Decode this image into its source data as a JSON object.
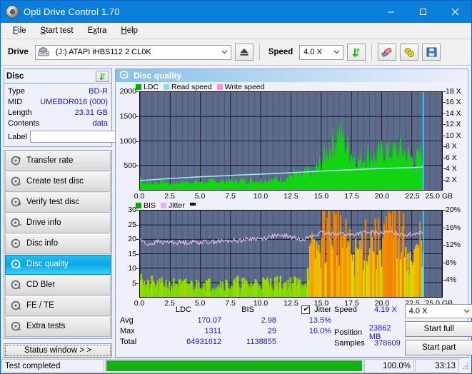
{
  "window": {
    "title": "Opti Drive Control 1.70",
    "icon": "disc-icon",
    "minimize": "–",
    "maximize": "□",
    "close": "✕"
  },
  "menu": [
    {
      "label": "File",
      "accel": "F"
    },
    {
      "label": "Start test",
      "accel": "S"
    },
    {
      "label": "Extra",
      "accel": "x"
    },
    {
      "label": "Help",
      "accel": "H"
    }
  ],
  "toolbar": {
    "drive_label": "Drive",
    "drive_value": "(J:)  ATAPI iHBS112  2 CL0K",
    "eject_icon": "eject-icon",
    "speed_label": "Speed",
    "speed_value": "4.0 X",
    "refresh_icon": "refresh-icon",
    "erase_icon": "eraser-icon",
    "disc_tools_icon": "disc-tools-icon",
    "save_icon": "save-icon"
  },
  "disc_panel": {
    "title": "Disc",
    "refresh_icon": "refresh-icon",
    "rows": [
      {
        "key": "Type",
        "value": "BD-R"
      },
      {
        "key": "MID",
        "value": "UMEBDR016 (000)"
      },
      {
        "key": "Length",
        "value": "23.31 GB"
      },
      {
        "key": "Contents",
        "value": "data"
      }
    ],
    "label_key": "Label",
    "label_value": "",
    "label_placeholder": "",
    "label_button_icon": "disc-icon"
  },
  "sidebar": {
    "items": [
      {
        "label": "Transfer rate",
        "icon": "disc-test-icon",
        "active": false
      },
      {
        "label": "Create test disc",
        "icon": "disc-write-icon",
        "active": false
      },
      {
        "label": "Verify test disc",
        "icon": "disc-verify-icon",
        "active": false
      },
      {
        "label": "Drive info",
        "icon": "drive-info-icon",
        "active": false
      },
      {
        "label": "Disc info",
        "icon": "disc-info-icon",
        "active": false
      },
      {
        "label": "Disc quality",
        "icon": "disc-quality-icon",
        "active": true
      },
      {
        "label": "CD Bler",
        "icon": "disc-bler-icon",
        "active": false
      },
      {
        "label": "FE / TE",
        "icon": "disc-fete-icon",
        "active": false
      },
      {
        "label": "Extra tests",
        "icon": "disc-extra-icon",
        "active": false
      }
    ],
    "status_window_button": "Status window > >"
  },
  "content": {
    "header_title": "Disc quality",
    "header_icon": "disc-quality-icon"
  },
  "chart_data": [
    {
      "id": "top",
      "type": "area",
      "title": "",
      "legend": [
        {
          "label": "LDC",
          "color": "#00a800"
        },
        {
          "label": "Read speed",
          "color": "#8fd8f0"
        },
        {
          "label": "Write speed",
          "color": "#ff8fd8"
        }
      ],
      "legend_position": "top-left",
      "xlabel": "GB",
      "xlim": [
        0.0,
        25.0
      ],
      "xticks": [
        "0.0",
        "2.5",
        "5.0",
        "7.5",
        "10.0",
        "12.5",
        "15.0",
        "17.5",
        "20.0",
        "22.5",
        "25.0"
      ],
      "ylabel": "",
      "ylim": [
        0,
        2000
      ],
      "yticks": [
        "500",
        "1000",
        "1500",
        "2000"
      ],
      "y2label": "",
      "y2lim": [
        0,
        18
      ],
      "y2ticks": [
        "2 X",
        "4 X",
        "6 X",
        "8 X",
        "10 X",
        "12 X",
        "14 X",
        "16 X",
        "18 X"
      ],
      "grid": true,
      "series": [
        {
          "name": "LDC",
          "color": "#00c800",
          "x": [
            0.0,
            0.3,
            0.6,
            1.0,
            1.5,
            2.0,
            2.5,
            3.0,
            3.5,
            4.0,
            4.5,
            5.0,
            5.5,
            6.0,
            6.5,
            7.0,
            7.5,
            8.0,
            8.5,
            9.0,
            9.5,
            10.0,
            10.5,
            11.0,
            11.5,
            12.0,
            12.4,
            12.8,
            13.1,
            13.5,
            13.9,
            14.2,
            14.6,
            15.0,
            15.3,
            15.6,
            15.9,
            16.2,
            16.5,
            16.8,
            17.1,
            17.4,
            17.7,
            18.0,
            18.4,
            18.8,
            19.2,
            19.6,
            20.0,
            20.4,
            20.8,
            21.2,
            21.6,
            22.0,
            22.4,
            22.8,
            23.2,
            23.4
          ],
          "values": [
            300,
            150,
            160,
            155,
            170,
            180,
            150,
            165,
            175,
            180,
            185,
            175,
            190,
            185,
            200,
            195,
            205,
            200,
            215,
            205,
            220,
            215,
            230,
            225,
            240,
            250,
            300,
            380,
            300,
            330,
            420,
            350,
            480,
            620,
            760,
            900,
            1050,
            1180,
            1311,
            1150,
            980,
            880,
            760,
            640,
            700,
            820,
            760,
            700,
            860,
            900,
            830,
            870,
            910,
            820,
            700,
            640,
            780,
            820
          ]
        },
        {
          "name": "Read speed",
          "color": "#a0e4fb",
          "x": [
            0.0,
            1.2,
            2.5,
            3.8,
            5.0,
            6.5,
            8.0,
            9.5,
            11.0,
            12.5,
            13.8,
            15.0,
            16.5,
            18.0,
            19.5,
            21.0,
            22.5,
            23.4
          ],
          "values": [
            1.7,
            1.9,
            2.1,
            2.25,
            2.4,
            2.55,
            2.7,
            2.85,
            3.0,
            3.15,
            3.3,
            3.45,
            3.6,
            3.75,
            3.9,
            4.0,
            4.1,
            4.19
          ]
        }
      ],
      "cursor_x": 23.45,
      "cursor_color": "#38e0ff"
    },
    {
      "id": "bottom",
      "type": "bar",
      "title": "",
      "legend": [
        {
          "label": "BIS",
          "color": "#00a800"
        },
        {
          "label": "Jitter",
          "color": "#e6b4e6"
        }
      ],
      "legend_position": "top-left",
      "xlabel": "GB",
      "xlim": [
        0.0,
        25.0
      ],
      "xticks": [
        "0.0",
        "2.5",
        "5.0",
        "7.5",
        "10.0",
        "12.5",
        "15.0",
        "17.5",
        "20.0",
        "22.5",
        "25.0"
      ],
      "ylabel": "",
      "ylim": [
        0,
        30
      ],
      "yticks": [
        "5",
        "10",
        "15",
        "20",
        "25",
        "30"
      ],
      "y2label": "",
      "y2lim": [
        0,
        20
      ],
      "y2ticks": [
        "4%",
        "8%",
        "12%",
        "16%",
        "20%"
      ],
      "grid": true,
      "series": [
        {
          "name": "BIS",
          "color_low": "#4cdc00",
          "color_mid": "#f0d400",
          "color_high": "#f08000",
          "x": [
            0.1,
            0.3,
            0.6,
            1.0,
            1.5,
            2.0,
            2.5,
            3.0,
            3.5,
            4.0,
            4.5,
            5.0,
            5.5,
            6.0,
            6.5,
            7.0,
            7.5,
            8.0,
            8.5,
            9.0,
            9.5,
            10.0,
            10.5,
            11.0,
            11.5,
            12.0,
            12.5,
            13.0,
            13.4,
            13.8,
            14.0,
            14.2,
            14.4,
            14.6,
            14.8,
            15.0,
            15.2,
            15.4,
            15.6,
            15.8,
            16.0,
            16.2,
            16.4,
            16.6,
            16.8,
            17.0,
            17.2,
            17.5,
            17.8,
            18.1,
            18.4,
            18.7,
            19.0,
            19.3,
            19.6,
            19.9,
            20.2,
            20.5,
            20.8,
            21.1,
            21.4,
            21.7,
            22.0,
            22.3,
            22.6,
            22.9,
            23.2,
            23.4
          ],
          "values": [
            11,
            5,
            4,
            5,
            4,
            5,
            4,
            5,
            4,
            5,
            4,
            5,
            5,
            4,
            5,
            5,
            4,
            5,
            5,
            4,
            5,
            5,
            5,
            5,
            5,
            5,
            5,
            5,
            5,
            6,
            12,
            16,
            14,
            18,
            15,
            20,
            25,
            22,
            29,
            24,
            27,
            22,
            26,
            20,
            23,
            18,
            20,
            15,
            14,
            16,
            18,
            21,
            19,
            22,
            17,
            20,
            23,
            21,
            24,
            22,
            26,
            19,
            21,
            13,
            12,
            15,
            20,
            22
          ]
        },
        {
          "name": "Jitter",
          "color": "#e8b8e8",
          "x": [
            0.0,
            0.5,
            1.0,
            1.5,
            2.0,
            2.5,
            3.0,
            3.5,
            4.0,
            4.5,
            5.0,
            5.5,
            6.0,
            6.5,
            7.0,
            7.5,
            8.0,
            8.5,
            9.0,
            9.5,
            10.0,
            10.5,
            11.0,
            11.5,
            12.0,
            12.5,
            13.0,
            13.5,
            14.0,
            14.5,
            15.0,
            15.5,
            16.0,
            16.5,
            17.0,
            17.5,
            18.0,
            18.5,
            19.0,
            19.5,
            20.0,
            20.5,
            21.0,
            21.5,
            22.0,
            22.5,
            23.0,
            23.4
          ],
          "values": [
            20.2,
            18.3,
            18.6,
            19.3,
            18.8,
            19.1,
            18.8,
            19.0,
            18.9,
            19.1,
            19.0,
            19.2,
            19.1,
            19.4,
            19.3,
            19.6,
            19.5,
            19.8,
            20.0,
            20.3,
            20.2,
            20.6,
            21.2,
            21.0,
            21.3,
            20.8,
            20.1,
            20.2,
            20.6,
            21.5,
            22.2,
            21.8,
            22.3,
            22.0,
            21.9,
            21.5,
            22.0,
            22.3,
            22.1,
            22.4,
            22.2,
            22.5,
            22.3,
            22.0,
            21.6,
            21.8,
            22.4,
            22.6
          ]
        }
      ],
      "cursor_x": 23.45,
      "cursor_color": "#38e0ff"
    }
  ],
  "stats": {
    "columns": [
      "LDC",
      "BIS"
    ],
    "jitter_label": "Jitter",
    "jitter_checked": true,
    "rows": [
      {
        "label": "Avg",
        "ldc": "170.07",
        "bis": "2.98",
        "jitter": "13.5%"
      },
      {
        "label": "Max",
        "ldc": "1311",
        "bis": "29",
        "jitter": "16.0%"
      },
      {
        "label": "Total",
        "ldc": "64931612",
        "bis": "1138855",
        "jitter": ""
      }
    ],
    "speed_key": "Speed",
    "speed_value": "4.19 X",
    "position_key": "Position",
    "position_value": "23862 MB",
    "samples_key": "Samples",
    "samples_value": "378609",
    "speed_select": "4.0 X",
    "start_full_button": "Start full",
    "start_part_button": "Start part"
  },
  "statusbar": {
    "status": "Test completed",
    "progress_percent": 100,
    "percent_text": "100.0%",
    "elapsed": "33:13"
  }
}
